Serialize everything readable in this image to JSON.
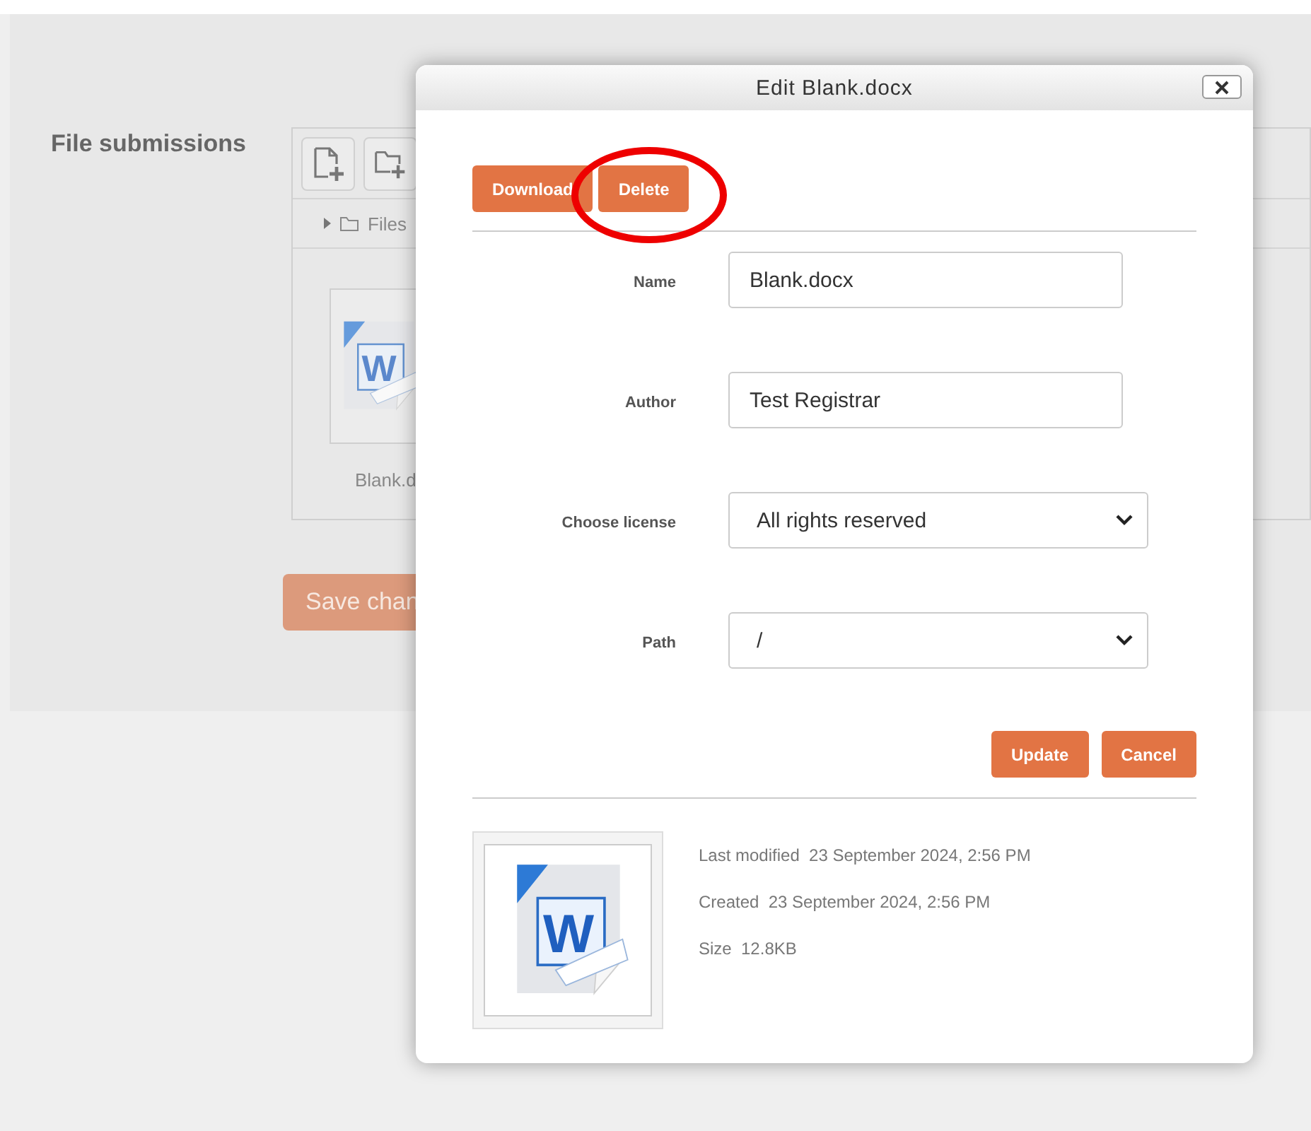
{
  "page": {
    "section_label": "File submissions",
    "breadcrumb": "Files",
    "file_name": "Blank.d",
    "file_icon_letter": "W",
    "save_button": "Save chan"
  },
  "dialog": {
    "title": "Edit Blank.docx",
    "actions": [
      "Download",
      "Delete"
    ],
    "fields": [
      {
        "kind": "text",
        "label": "Name",
        "value": "Blank.docx"
      },
      {
        "kind": "text",
        "label": "Author",
        "value": "Test Registrar"
      },
      {
        "kind": "select",
        "label": "Choose license",
        "value": "All rights reserved"
      },
      {
        "kind": "select",
        "label": "Path",
        "value": "/"
      }
    ],
    "buttons": [
      "Update",
      "Cancel"
    ],
    "preview_icon_letter": "W",
    "details": [
      {
        "label": "Last modified",
        "value": "23 September 2024, 2:56 PM"
      },
      {
        "label": "Created",
        "value": "23 September 2024, 2:56 PM"
      },
      {
        "label": "Size",
        "value": "12.8KB"
      }
    ]
  }
}
